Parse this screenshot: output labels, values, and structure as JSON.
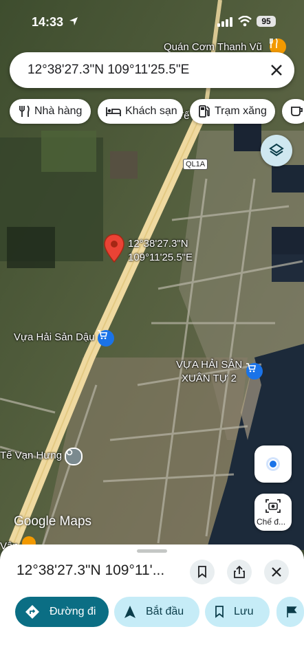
{
  "status_bar": {
    "time": "14:33",
    "battery": "95"
  },
  "search": {
    "query": "12°38'27.3\"N 109°11'25.5\"E"
  },
  "chips": [
    {
      "label": "Nhà hàng",
      "icon": "fork-knife-icon"
    },
    {
      "label": "Khách sạn",
      "icon": "bed-icon"
    },
    {
      "label": "Trạm xăng",
      "icon": "gas-station-icon"
    },
    {
      "label": "",
      "icon": "coffee-icon"
    }
  ],
  "map": {
    "road_badge": "QL1A",
    "pin_label_line1": "12°38'27.3\"N",
    "pin_label_line2": "109°11'25.5\"E",
    "places": {
      "top_right": "Quán Cơm Thanh Vũ",
      "seafood_1": "Vựa Hải Sản Dậu",
      "seafood_2_line1": "VỰA HẢI SẢN",
      "seafood_2_line2": "XUÂN TỰ 2",
      "left_place": "Tế Vạn Hưng",
      "bottom_left": "Vân",
      "partial_top": "Tế"
    },
    "watermark": "Google Maps"
  },
  "camera_button": {
    "label": "Chế đ..."
  },
  "sheet": {
    "title": "12°38'27.3\"N 109°11'...",
    "actions": [
      {
        "label": "Đường đi",
        "icon": "directions-icon"
      },
      {
        "label": "Bắt đầu",
        "icon": "navigation-arrow-icon"
      },
      {
        "label": "Lưu",
        "icon": "bookmark-icon"
      },
      {
        "label": "",
        "icon": "flag-icon"
      }
    ]
  },
  "colors": {
    "accent": "#0b6e84",
    "chip_tint": "#c6ecf7",
    "pin_red": "#ea4335",
    "poi_blue": "#1a73e8",
    "poi_orange": "#f29900"
  }
}
